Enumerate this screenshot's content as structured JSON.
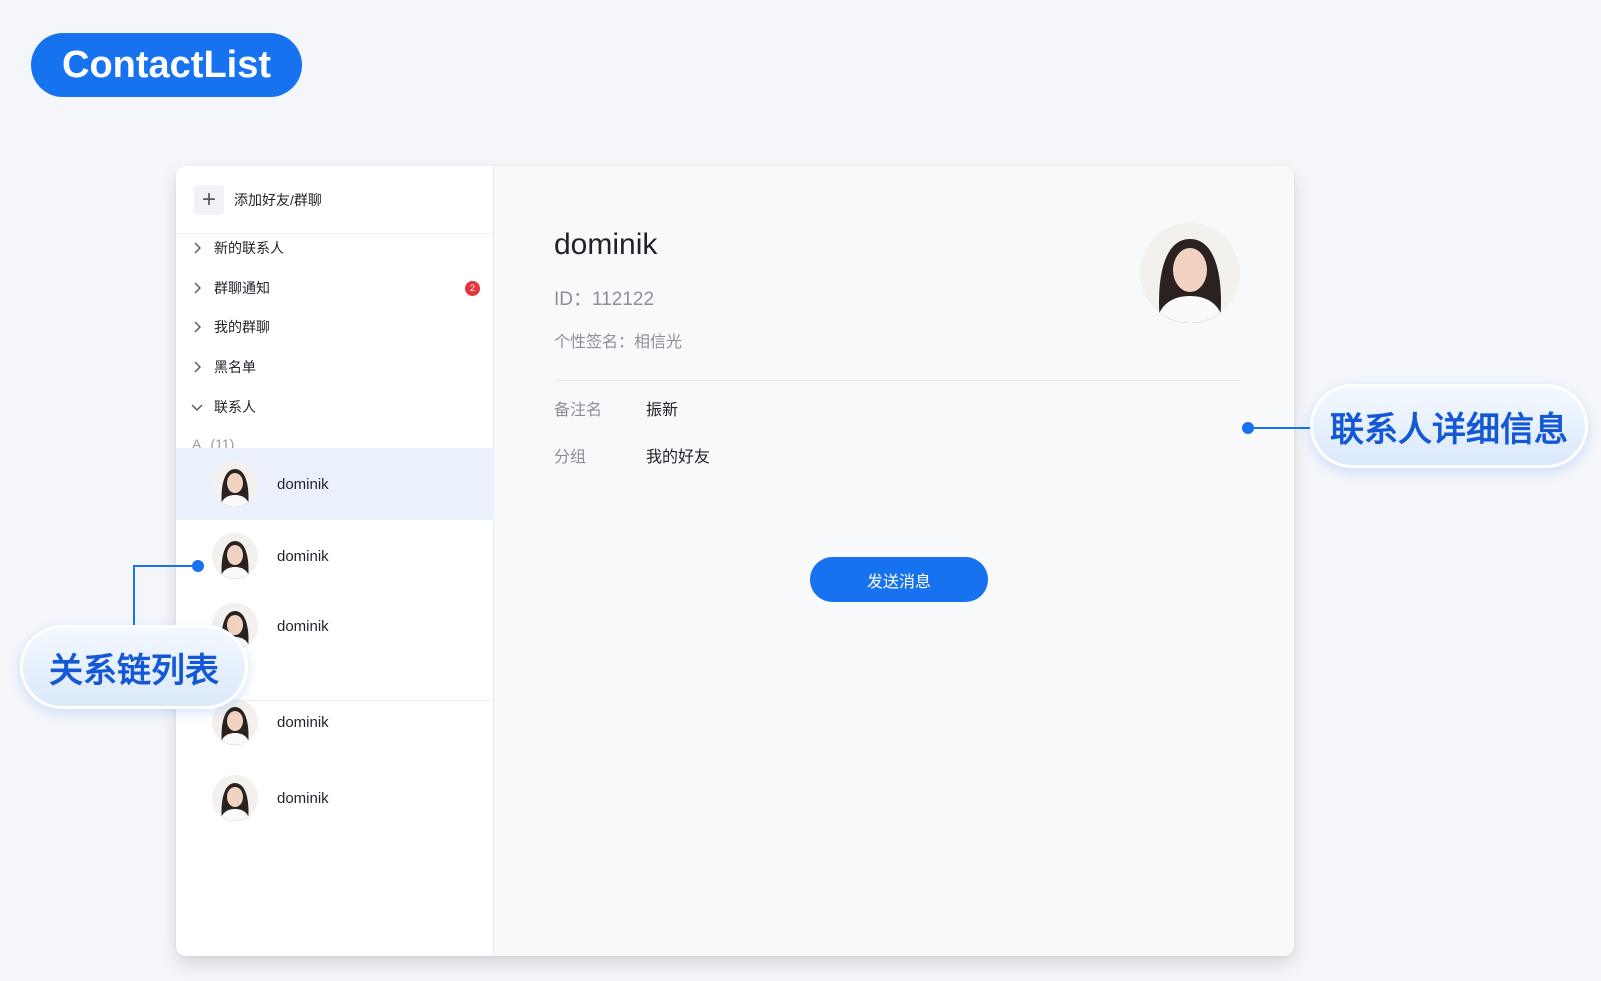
{
  "header": {
    "title": "ContactList"
  },
  "sidebar": {
    "add_label": "添加好友/群聊",
    "menu": [
      {
        "label": "新的联系人",
        "expanded": false
      },
      {
        "label": "群聊通知",
        "expanded": false,
        "badge": "2"
      },
      {
        "label": "我的群聊",
        "expanded": false
      },
      {
        "label": "黑名单",
        "expanded": false
      },
      {
        "label": "联系人",
        "expanded": true
      }
    ],
    "group_letter": "A",
    "group_count": "(11)",
    "contacts": [
      {
        "name": "dominik",
        "selected": true
      },
      {
        "name": "dominik",
        "selected": false
      },
      {
        "name": "dominik",
        "selected": false
      },
      {
        "name": "dominik",
        "selected": false
      },
      {
        "name": "dominik",
        "selected": false
      }
    ]
  },
  "detail": {
    "name": "dominik",
    "id_label": "ID：",
    "id_value": "112122",
    "signature_label": "个性签名：",
    "signature_value": "相信光",
    "remark_label": "备注名",
    "remark_value": "振新",
    "group_label": "分组",
    "group_value": "我的好友",
    "send_label": "发送消息"
  },
  "annotations": {
    "detail_callout": "联系人详细信息",
    "list_callout": "关系链列表"
  },
  "colors": {
    "accent": "#1772ef",
    "badge": "#e5353a",
    "selected_row": "#eaf1fd"
  }
}
